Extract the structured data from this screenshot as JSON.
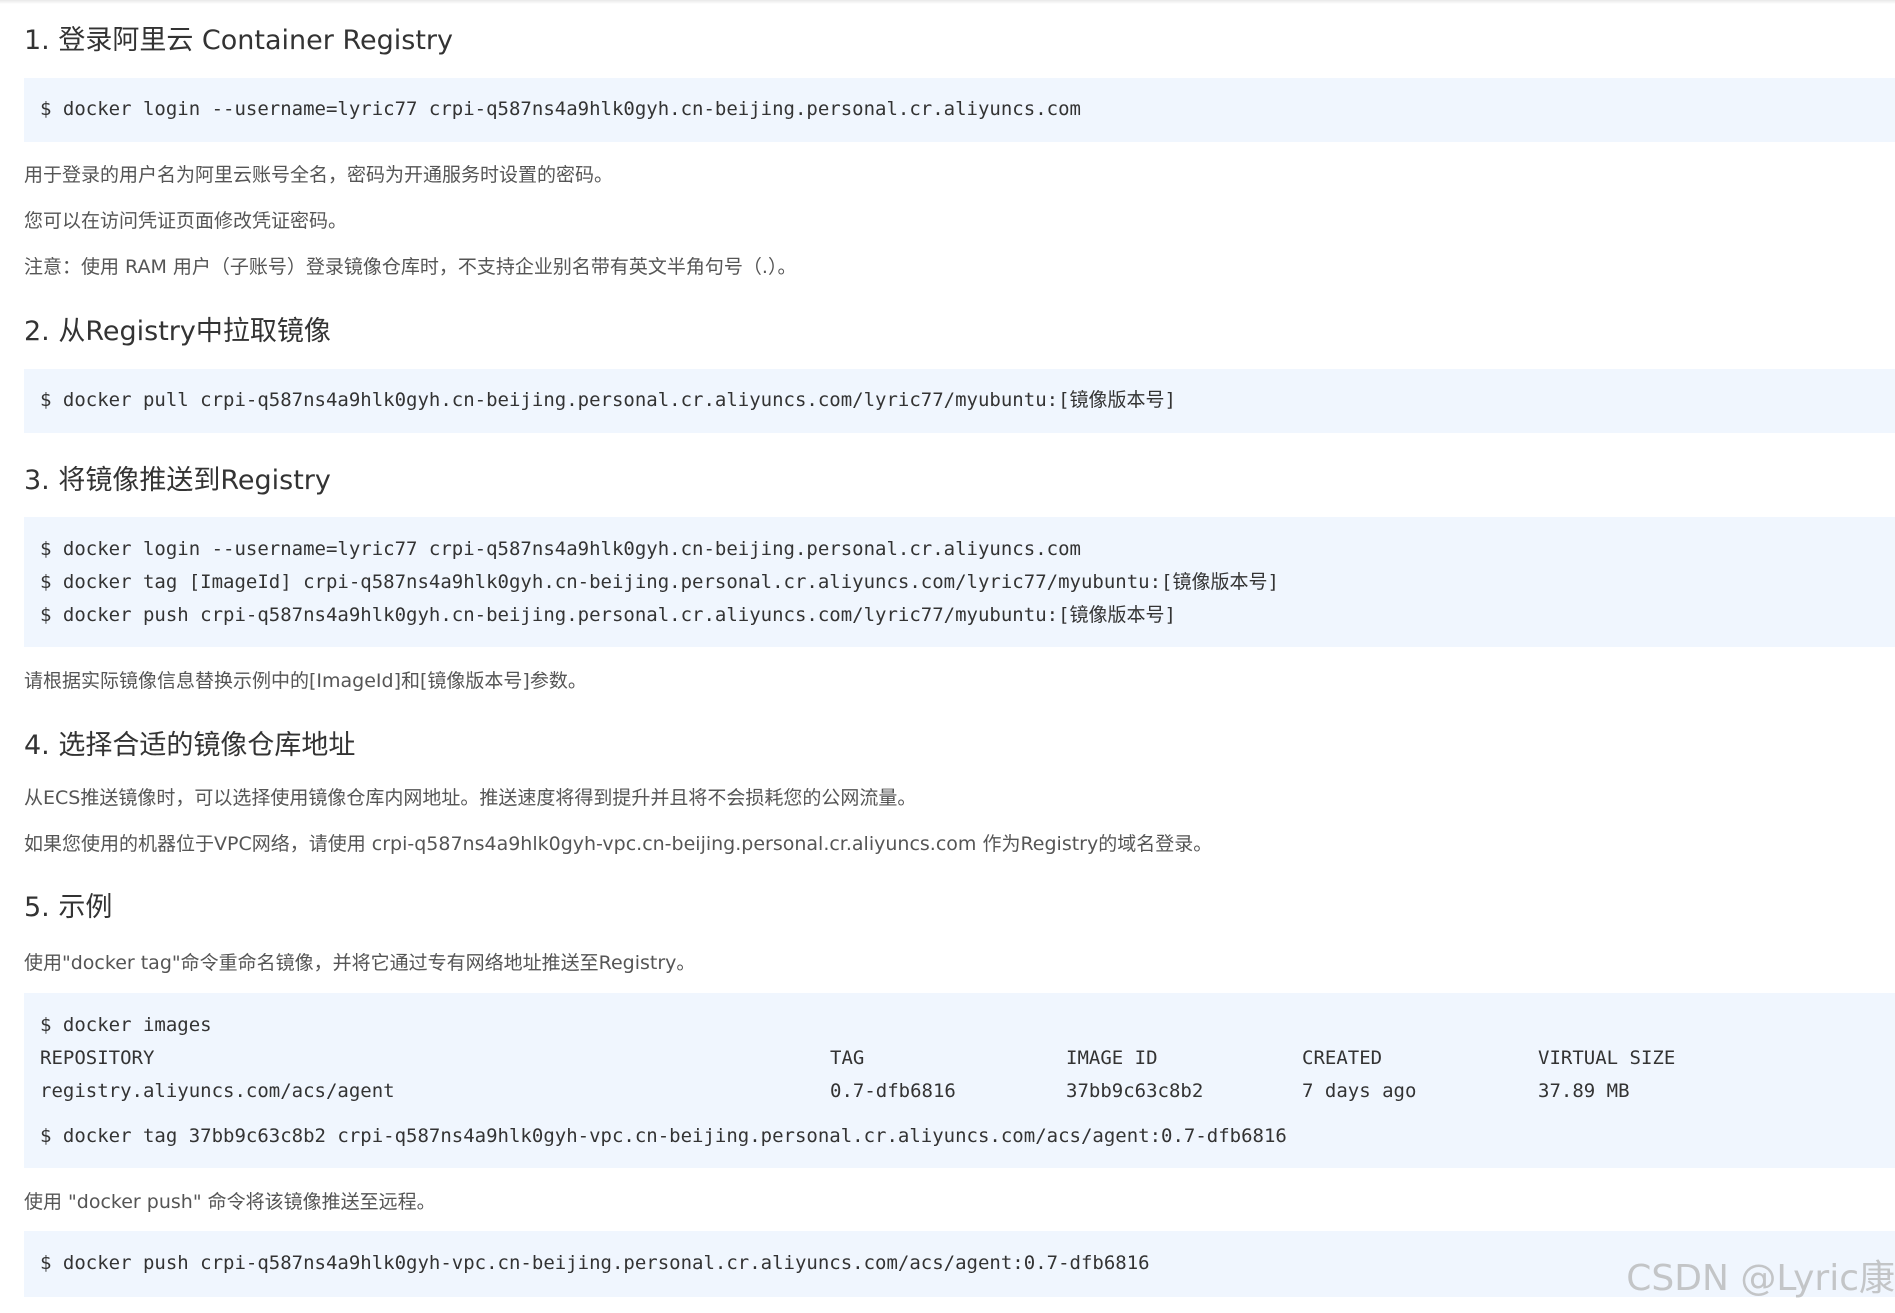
{
  "sections": {
    "s1": {
      "title": "1. 登录阿里云 Container Registry",
      "code": [
        "$ docker login --username=lyric77 crpi-q587ns4a9hlk0gyh.cn-beijing.personal.cr.aliyuncs.com"
      ],
      "notes": [
        "用于登录的用户名为阿里云账号全名，密码为开通服务时设置的密码。",
        "您可以在访问凭证页面修改凭证密码。",
        "注意：使用 RAM 用户（子账号）登录镜像仓库时，不支持企业别名带有英文半角句号（.）。"
      ]
    },
    "s2": {
      "title": "2. 从Registry中拉取镜像",
      "code": [
        "$ docker pull crpi-q587ns4a9hlk0gyh.cn-beijing.personal.cr.aliyuncs.com/lyric77/myubuntu:[镜像版本号]"
      ]
    },
    "s3": {
      "title": "3. 将镜像推送到Registry",
      "code": [
        "$ docker login --username=lyric77 crpi-q587ns4a9hlk0gyh.cn-beijing.personal.cr.aliyuncs.com",
        "$ docker tag [ImageId] crpi-q587ns4a9hlk0gyh.cn-beijing.personal.cr.aliyuncs.com/lyric77/myubuntu:[镜像版本号]",
        "$ docker push crpi-q587ns4a9hlk0gyh.cn-beijing.personal.cr.aliyuncs.com/lyric77/myubuntu:[镜像版本号]"
      ],
      "notes": [
        "请根据实际镜像信息替换示例中的[ImageId]和[镜像版本号]参数。"
      ]
    },
    "s4": {
      "title": "4. 选择合适的镜像仓库地址",
      "notes": [
        "从ECS推送镜像时，可以选择使用镜像仓库内网地址。推送速度将得到提升并且将不会损耗您的公网流量。",
        "如果您使用的机器位于VPC网络，请使用 crpi-q587ns4a9hlk0gyh-vpc.cn-beijing.personal.cr.aliyuncs.com 作为Registry的域名登录。"
      ]
    },
    "s5": {
      "title": "5. 示例",
      "intro": "使用\"docker tag\"命令重命名镜像，并将它通过专有网络地址推送至Registry。",
      "images_cmd": "$ docker images",
      "table_headers": [
        "REPOSITORY",
        "TAG",
        "IMAGE ID",
        "CREATED",
        "VIRTUAL SIZE"
      ],
      "table_row": [
        "registry.aliyuncs.com/acs/agent",
        "0.7-dfb6816",
        "37bb9c63c8b2",
        "7 days ago",
        "37.89 MB"
      ],
      "tag_cmd": "$ docker tag 37bb9c63c8b2 crpi-q587ns4a9hlk0gyh-vpc.cn-beijing.personal.cr.aliyuncs.com/acs/agent:0.7-dfb6816",
      "push_intro": "使用 \"docker push\" 命令将该镜像推送至远程。",
      "push_cmd": "$ docker push crpi-q587ns4a9hlk0gyh-vpc.cn-beijing.personal.cr.aliyuncs.com/acs/agent:0.7-dfb6816"
    }
  },
  "watermark": "CSDN @Lyric康",
  "colors": {
    "code_bg": "#f0f6fe",
    "heading": "#333333",
    "body_text": "#555555"
  }
}
